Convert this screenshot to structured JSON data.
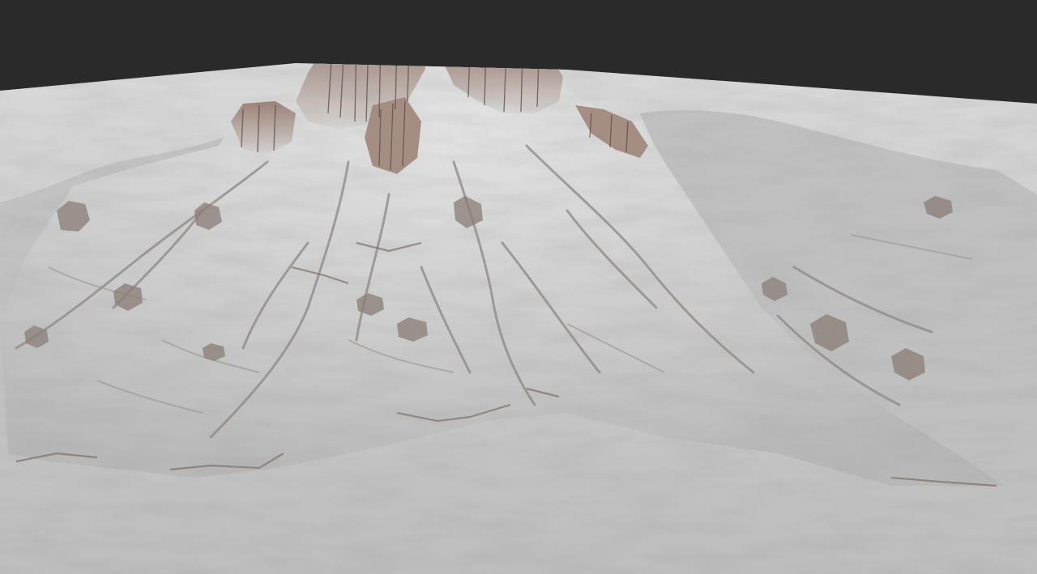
{
  "scene": {
    "subject": "terrain-render",
    "colors": {
      "background": "#2a2a2a",
      "plain": "#c4c4c4",
      "plain_far": "#cfcfcf",
      "terrain_light": "#d8d8d8",
      "terrain_mid": "#a9a9a9",
      "terrain_shadow": "#7d746f",
      "cliff_brown": "#8a6e62",
      "cliff_dark": "#5e4b44"
    }
  }
}
